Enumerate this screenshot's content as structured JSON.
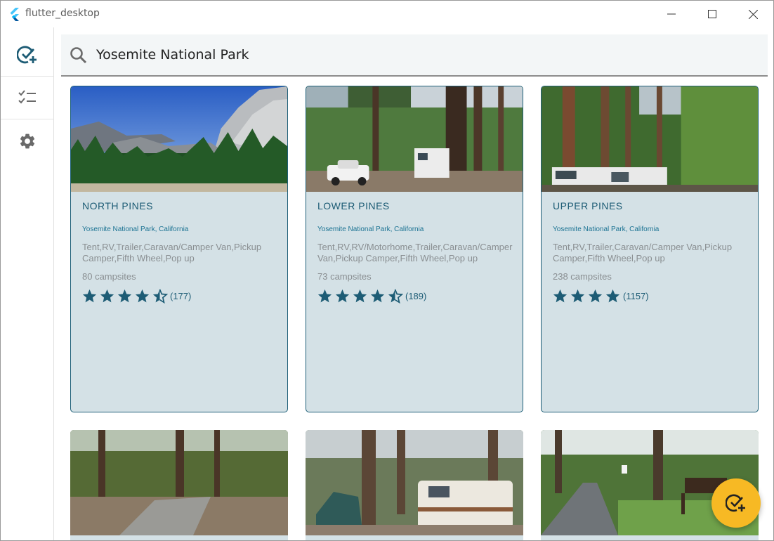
{
  "window": {
    "title": "flutter_desktop"
  },
  "search": {
    "value": "Yosemite National Park"
  },
  "nav": [
    {
      "icon": "add-check-icon",
      "selected": true
    },
    {
      "icon": "checklist-icon",
      "selected": false
    },
    {
      "icon": "gear-icon",
      "selected": false
    }
  ],
  "cards": [
    {
      "name": "NORTH PINES",
      "location": "Yosemite National Park, California",
      "types": "Tent,RV,Trailer,Caravan/Camper Van,Pickup Camper,Fifth Wheel,Pop up",
      "sites": "80 campsites",
      "rating": 4.5,
      "reviews": "(177)"
    },
    {
      "name": "LOWER PINES",
      "location": "Yosemite National Park, California",
      "types": "Tent,RV,RV/Motorhome,Trailer,Caravan/Camper Van,Pickup Camper,Fifth Wheel,Pop up",
      "sites": "73 campsites",
      "rating": 4.5,
      "reviews": "(189)"
    },
    {
      "name": "UPPER PINES",
      "location": "Yosemite National Park, California",
      "types": "Tent,RV,Trailer,Caravan/Camper Van,Pickup Camper,Fifth Wheel,Pop up",
      "sites": "238 campsites",
      "rating": 4,
      "reviews": "(1157)"
    }
  ],
  "colors": {
    "accent": "#1d5c75",
    "card_bg": "#d4e1e6",
    "fab": "#f7b924"
  },
  "fab": {
    "icon": "add-check-icon"
  }
}
